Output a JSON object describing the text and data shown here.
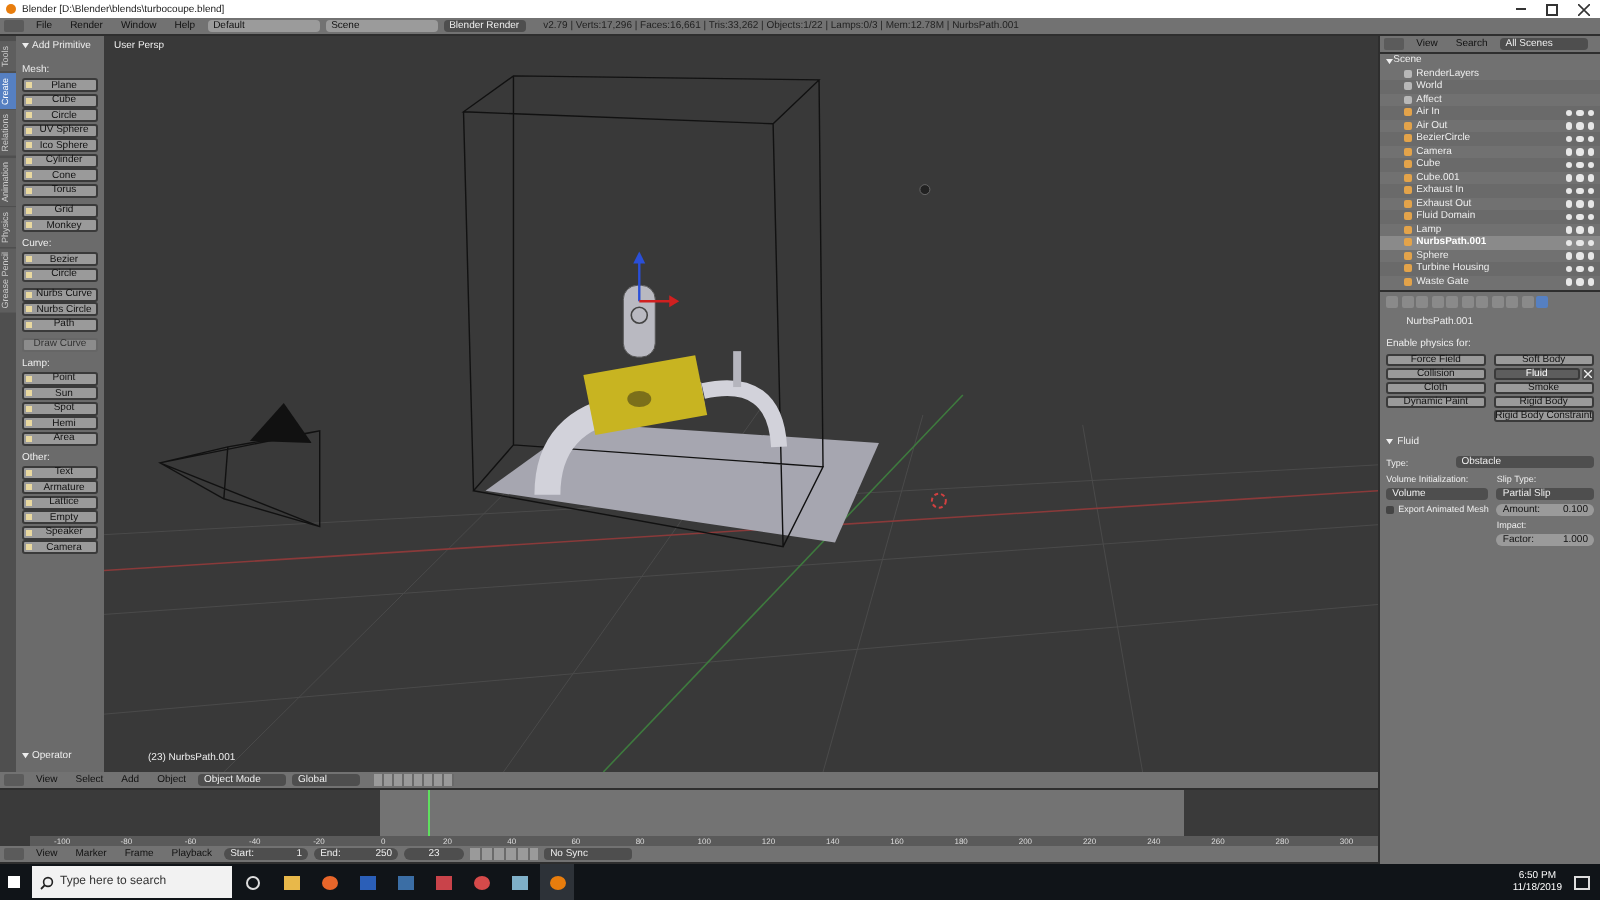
{
  "window": {
    "title": "Blender [D:\\Blender\\blends\\turbocoupe.blend]"
  },
  "info_header": {
    "menus": [
      "File",
      "Render",
      "Window",
      "Help"
    ],
    "layout": "Default",
    "scene": "Scene",
    "engine": "Blender Render",
    "stats": "v2.79 | Verts:17,296 | Faces:16,661 | Tris:33,262 | Objects:1/22 | Lamps:0/3 | Mem:12.78M | NurbsPath.001"
  },
  "toolbar": {
    "tabs": [
      {
        "label": "Tools",
        "selected": false
      },
      {
        "label": "Create",
        "selected": true
      },
      {
        "label": "Relations",
        "selected": false
      },
      {
        "label": "Animation",
        "selected": false
      },
      {
        "label": "Physics",
        "selected": false
      },
      {
        "label": "Grease Pencil",
        "selected": false
      }
    ],
    "panel": "Add Primitive",
    "sections": [
      {
        "title": "Mesh:",
        "items": [
          "Plane",
          "Cube",
          "Circle",
          "UV Sphere",
          "Ico Sphere",
          "Cylinder",
          "Cone",
          "Torus"
        ],
        "more": [
          "Grid",
          "Monkey"
        ]
      },
      {
        "title": "Curve:",
        "items": [
          "Bezier",
          "Circle"
        ],
        "more": [
          "Nurbs Curve",
          "Nurbs Circle",
          "Path"
        ],
        "extra": {
          "label": "Draw Curve",
          "disabled": true
        }
      },
      {
        "title": "Lamp:",
        "items": [
          "Point",
          "Sun",
          "Spot",
          "Hemi",
          "Area"
        ]
      },
      {
        "title": "Other:",
        "items": [
          "Text",
          "Armature",
          "Lattice",
          "Empty",
          "Speaker",
          "Camera"
        ]
      }
    ],
    "operator": "Operator"
  },
  "viewport": {
    "view_label": "User Persp",
    "object_label": "(23) NurbsPath.001"
  },
  "view3d_header": {
    "menus": [
      "View",
      "Select",
      "Add",
      "Object"
    ],
    "mode": "Object Mode",
    "orientation": "Global"
  },
  "timeline": {
    "ruler": [
      "-100",
      "-80",
      "-60",
      "-40",
      "-20",
      "0",
      "20",
      "40",
      "60",
      "80",
      "100",
      "120",
      "140",
      "160",
      "180",
      "200",
      "220",
      "240",
      "260",
      "280",
      "300"
    ],
    "playhead": {
      "level": 0.31
    }
  },
  "timeline_header": {
    "menus": [
      "View",
      "Marker",
      "Frame",
      "Playback"
    ],
    "start": "Start:",
    "start_value": "1",
    "end": "End:",
    "end_value": "250",
    "frame": "23",
    "sync": "No Sync"
  },
  "outliner": {
    "menus": [
      "View",
      "Search"
    ],
    "filter": "All Scenes",
    "tree": [
      {
        "name": "Scene",
        "expanded": true,
        "children": [
          {
            "name": "RenderLayers",
            "kind": "setting",
            "selected": false
          },
          {
            "name": "World",
            "kind": "setting",
            "selected": false
          },
          {
            "name": "Affect",
            "kind": "setting",
            "selected": false
          },
          {
            "name": "Air In",
            "kind": "object",
            "selected": false
          },
          {
            "name": "Air Out",
            "kind": "object",
            "selected": false
          },
          {
            "name": "BezierCircle",
            "kind": "object",
            "selected": false
          },
          {
            "name": "Camera",
            "kind": "object",
            "selected": false
          },
          {
            "name": "Cube",
            "kind": "object",
            "selected": false
          },
          {
            "name": "Cube.001",
            "kind": "object",
            "selected": false
          },
          {
            "name": "Exhaust In",
            "kind": "object",
            "selected": false
          },
          {
            "name": "Exhaust Out",
            "kind": "object",
            "selected": false
          },
          {
            "name": "Fluid Domain",
            "kind": "object",
            "selected": false
          },
          {
            "name": "Lamp",
            "kind": "object",
            "selected": false
          },
          {
            "name": "NurbsPath.001",
            "kind": "object",
            "selected": true
          },
          {
            "name": "Sphere",
            "kind": "object",
            "selected": false
          },
          {
            "name": "Turbine Housing",
            "kind": "object",
            "selected": false
          },
          {
            "name": "Waste Gate",
            "kind": "object",
            "selected": false
          }
        ]
      }
    ]
  },
  "properties": {
    "tabs": [
      {
        "selected": false
      },
      {
        "selected": false
      },
      {
        "selected": false
      },
      {
        "selected": false
      },
      {
        "selected": false
      },
      {
        "selected": false
      },
      {
        "selected": false
      },
      {
        "selected": false
      },
      {
        "selected": false
      },
      {
        "selected": false
      },
      {
        "selected": true
      }
    ],
    "object_name": "NurbsPath.001",
    "enable_label": "Enable physics for:",
    "physics_buttons": [
      {
        "label": "Force Field",
        "on": false
      },
      {
        "label": "Soft Body",
        "on": false
      },
      {
        "label": "Collision",
        "on": false
      },
      {
        "label": "Fluid",
        "on": true
      },
      {
        "label": "Cloth",
        "on": false
      },
      {
        "label": "Smoke",
        "on": false
      },
      {
        "label": "Dynamic Paint",
        "on": false
      },
      {
        "label": "Rigid Body",
        "on": false
      },
      {
        "label": "Rigid Body Constraint",
        "on": false
      }
    ],
    "fluid": {
      "title": "Fluid",
      "expanded": true,
      "type_label": "Type:",
      "type": "Obstacle",
      "volume_label": "Volume Initialization:",
      "volume": "Volume",
      "slip_label": "Slip Type:",
      "slip": "Partial Slip",
      "export_label": "Export Animated Mesh",
      "export_checked": false,
      "amount_label": "Amount:",
      "amount": "0.100",
      "impact_label": "Impact:",
      "factor_label": "Factor:",
      "factor": "1.000"
    }
  },
  "taskbar": {
    "search_placeholder": "Type here to search",
    "time": "6:50 PM",
    "date": "11/18/2019"
  }
}
